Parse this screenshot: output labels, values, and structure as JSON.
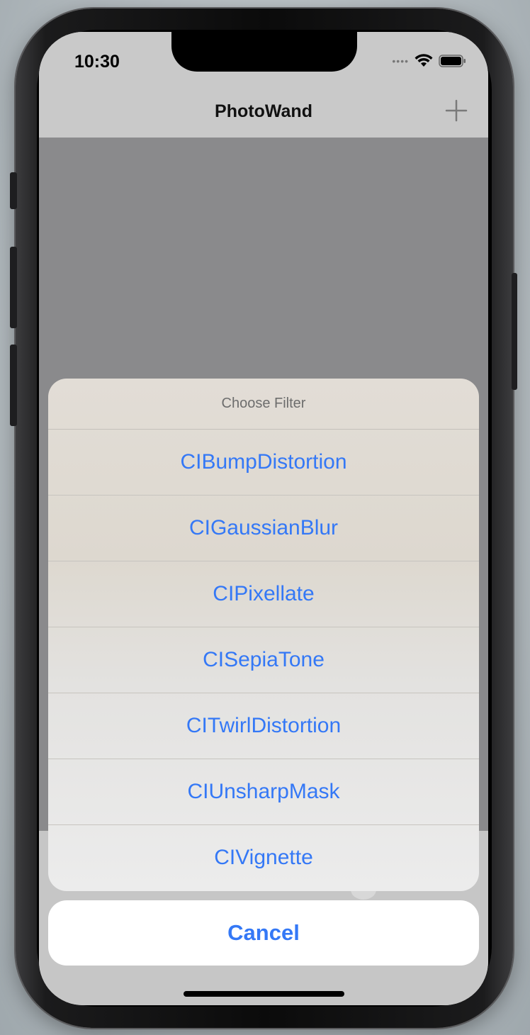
{
  "status_bar": {
    "time": "10:30"
  },
  "nav": {
    "title": "PhotoWand",
    "add_icon": "plus-icon"
  },
  "action_sheet": {
    "title": "Choose Filter",
    "options": [
      "CIBumpDistortion",
      "CIGaussianBlur",
      "CIPixellate",
      "CISepiaTone",
      "CITwirlDistortion",
      "CIUnsharpMask",
      "CIVignette"
    ],
    "cancel_label": "Cancel"
  },
  "colors": {
    "accent": "#3478f6",
    "nav_background": "#c9c9c9",
    "content_background": "#8a8a8c"
  }
}
